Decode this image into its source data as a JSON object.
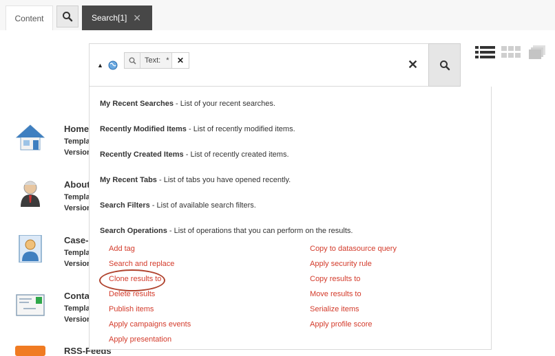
{
  "tabs": {
    "content_label": "Content",
    "active_label": "Search[1]",
    "close_glyph": "✕"
  },
  "search": {
    "token_label": "Text:",
    "token_value": "*",
    "token_remove": "✕",
    "clear_glyph": "✕"
  },
  "dropdown": {
    "entries": [
      {
        "title": "My Recent Searches",
        "desc": " - List of your recent searches."
      },
      {
        "title": "Recently Modified Items",
        "desc": " - List of recently modified items."
      },
      {
        "title": "Recently Created Items",
        "desc": " - List of recently created items."
      },
      {
        "title": "My Recent Tabs",
        "desc": " - List of tabs you have opened recently."
      },
      {
        "title": "Search Filters",
        "desc": " - List of available search filters."
      },
      {
        "title": "Search Operations",
        "desc": " - List of operations that you can perform on the results."
      }
    ],
    "operations_left": [
      "Add tag",
      "Search and replace",
      "Clone results to",
      "Delete results",
      "Publish items",
      "Apply campaigns events",
      "Apply presentation"
    ],
    "operations_right": [
      "Copy to datasource query",
      "Apply security rule",
      "Copy results to",
      "Move results to",
      "Serialize items",
      "Apply profile score"
    ]
  },
  "results": [
    {
      "title": "Home",
      "meta1": "Templa",
      "meta2": "Version",
      "icon": "home-icon"
    },
    {
      "title": "About",
      "meta1": "Templa",
      "meta2": "Version",
      "icon": "person-icon"
    },
    {
      "title": "Case-",
      "meta1": "Templa",
      "meta2": "Version",
      "icon": "portrait-icon"
    },
    {
      "title": "Conta",
      "meta1": "Templa",
      "meta2": "Version",
      "icon": "envelope-icon"
    },
    {
      "title": "RSS-Feeds",
      "icon": "rss-icon"
    }
  ],
  "colors": {
    "link": "#d33a2a",
    "active_tab": "#474747",
    "highlight": "#b0442f"
  }
}
